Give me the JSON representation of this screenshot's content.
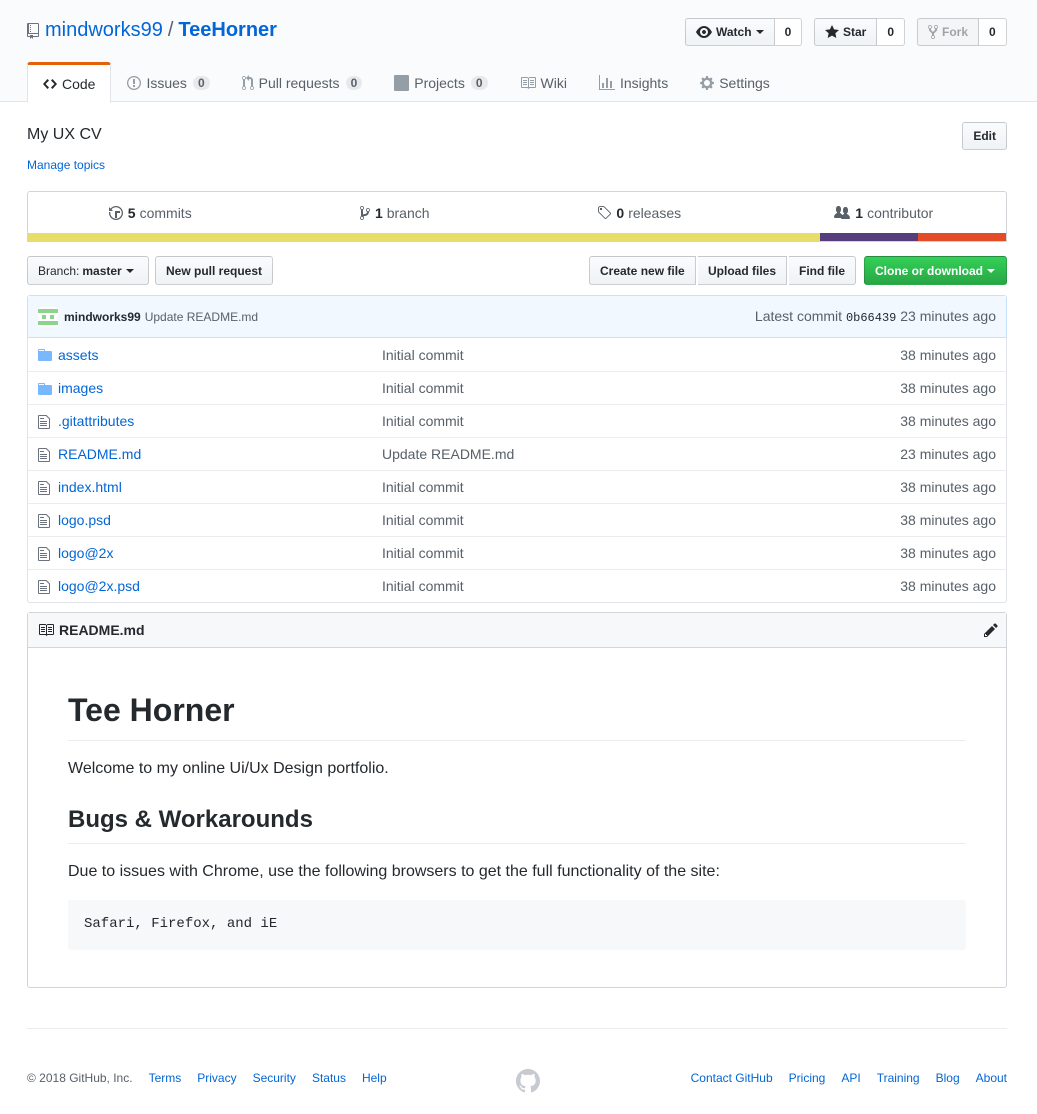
{
  "repo": {
    "owner": "mindworks99",
    "separator": "/",
    "name": "TeeHorner"
  },
  "actions": {
    "watch": {
      "label": "Watch",
      "count": "0"
    },
    "star": {
      "label": "Star",
      "count": "0"
    },
    "fork": {
      "label": "Fork",
      "count": "0"
    }
  },
  "tabs": [
    {
      "label": "Code",
      "counter": null,
      "icon": "code-icon",
      "selected": true
    },
    {
      "label": "Issues",
      "counter": "0",
      "icon": "issue-icon"
    },
    {
      "label": "Pull requests",
      "counter": "0",
      "icon": "pull-request-icon"
    },
    {
      "label": "Projects",
      "counter": "0",
      "icon": "project-icon"
    },
    {
      "label": "Wiki",
      "counter": null,
      "icon": "book-icon"
    },
    {
      "label": "Insights",
      "counter": null,
      "icon": "graph-icon"
    },
    {
      "label": "Settings",
      "counter": null,
      "icon": "gear-icon"
    }
  ],
  "description": "My UX CV",
  "manage_topics": "Manage topics",
  "edit_label": "Edit",
  "summary": {
    "commits_num": "5",
    "commits_label": "commits",
    "branch_num": "1",
    "branch_label": "branch",
    "releases_num": "0",
    "releases_label": "releases",
    "contributor_num": "1",
    "contributor_label": "contributor"
  },
  "languages": [
    {
      "color": "#e8dc6b",
      "share": 81
    },
    {
      "color": "#563d7c",
      "share": 10
    },
    {
      "color": "#e34c26",
      "share": 9
    }
  ],
  "file_nav": {
    "branch_label": "Branch:",
    "branch_value": "master",
    "new_pr": "New pull request",
    "create_file": "Create new file",
    "upload_files": "Upload files",
    "find_file": "Find file",
    "clone": "Clone or download"
  },
  "latest_commit": {
    "author": "mindworks99",
    "message": "Update README.md",
    "prefix": "Latest commit",
    "sha": "0b66439",
    "age": "23 minutes ago"
  },
  "files": [
    {
      "name": "assets",
      "type": "dir",
      "message": "Initial commit",
      "age": "38 minutes ago"
    },
    {
      "name": "images",
      "type": "dir",
      "message": "Initial commit",
      "age": "38 minutes ago"
    },
    {
      "name": ".gitattributes",
      "type": "file",
      "message": "Initial commit",
      "age": "38 minutes ago"
    },
    {
      "name": "README.md",
      "type": "file",
      "message": "Update README.md",
      "age": "23 minutes ago"
    },
    {
      "name": "index.html",
      "type": "file",
      "message": "Initial commit",
      "age": "38 minutes ago"
    },
    {
      "name": "logo.psd",
      "type": "file",
      "message": "Initial commit",
      "age": "38 minutes ago"
    },
    {
      "name": "logo@2x",
      "type": "file",
      "message": "Initial commit",
      "age": "38 minutes ago"
    },
    {
      "name": "logo@2x.psd",
      "type": "file",
      "message": "Initial commit",
      "age": "38 minutes ago"
    }
  ],
  "readme": {
    "filename": "README.md",
    "h1": "Tee Horner",
    "p1": "Welcome to my online Ui/Ux Design portfolio.",
    "h2": "Bugs & Workarounds",
    "p2": "Due to issues with Chrome, use the following browsers to get the full functionality of the site:",
    "code": "Safari, Firefox, and iE"
  },
  "footer": {
    "copyright": "© 2018 GitHub, Inc.",
    "left_links": [
      "Terms",
      "Privacy",
      "Security",
      "Status",
      "Help"
    ],
    "right_links": [
      "Contact GitHub",
      "Pricing",
      "API",
      "Training",
      "Blog",
      "About"
    ]
  }
}
